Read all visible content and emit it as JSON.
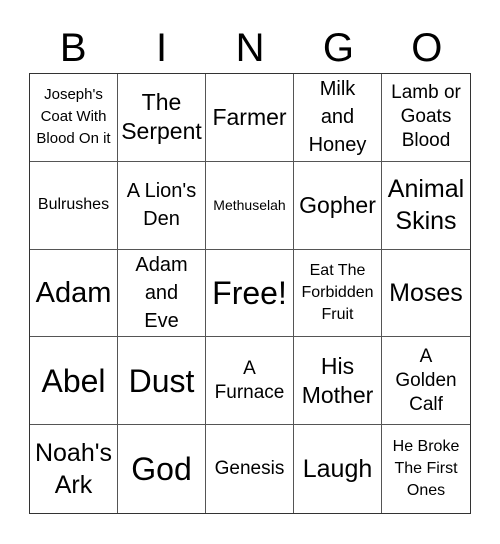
{
  "header": [
    "B",
    "I",
    "N",
    "G",
    "O"
  ],
  "cells": [
    "Joseph's Coat With Blood On it",
    "The Serpent",
    "Farmer",
    "Milk and Honey",
    "Lamb or Goats Blood",
    "Bulrushes",
    "A Lion's Den",
    "Methuselah",
    "Gopher",
    "Animal Skins",
    "Adam",
    "Adam and Eve",
    "Free!",
    "Eat The Forbidden Fruit",
    "Moses",
    "Abel",
    "Dust",
    "A Furnace",
    "His Mother",
    "A Golden Calf",
    "Noah's Ark",
    "God",
    "Genesis",
    "Laugh",
    "He Broke The First Ones"
  ]
}
